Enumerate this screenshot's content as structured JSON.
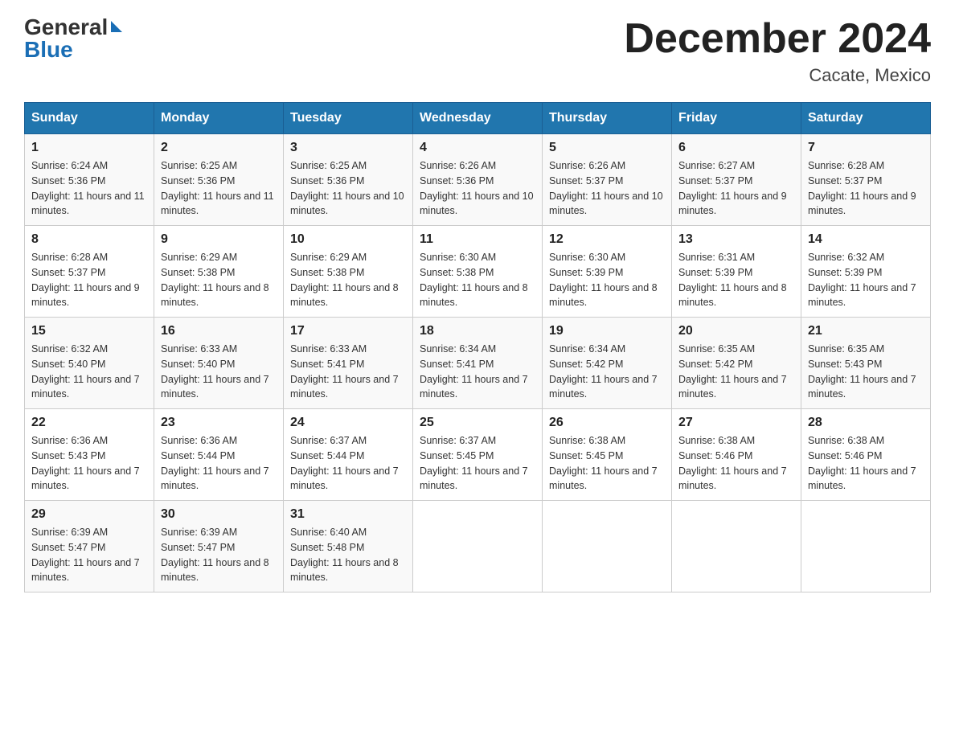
{
  "header": {
    "logo_general": "General",
    "logo_blue": "Blue",
    "month_year": "December 2024",
    "location": "Cacate, Mexico"
  },
  "weekdays": [
    "Sunday",
    "Monday",
    "Tuesday",
    "Wednesday",
    "Thursday",
    "Friday",
    "Saturday"
  ],
  "weeks": [
    [
      {
        "day": "1",
        "sunrise": "6:24 AM",
        "sunset": "5:36 PM",
        "daylight": "11 hours and 11 minutes."
      },
      {
        "day": "2",
        "sunrise": "6:25 AM",
        "sunset": "5:36 PM",
        "daylight": "11 hours and 11 minutes."
      },
      {
        "day": "3",
        "sunrise": "6:25 AM",
        "sunset": "5:36 PM",
        "daylight": "11 hours and 10 minutes."
      },
      {
        "day": "4",
        "sunrise": "6:26 AM",
        "sunset": "5:36 PM",
        "daylight": "11 hours and 10 minutes."
      },
      {
        "day": "5",
        "sunrise": "6:26 AM",
        "sunset": "5:37 PM",
        "daylight": "11 hours and 10 minutes."
      },
      {
        "day": "6",
        "sunrise": "6:27 AM",
        "sunset": "5:37 PM",
        "daylight": "11 hours and 9 minutes."
      },
      {
        "day": "7",
        "sunrise": "6:28 AM",
        "sunset": "5:37 PM",
        "daylight": "11 hours and 9 minutes."
      }
    ],
    [
      {
        "day": "8",
        "sunrise": "6:28 AM",
        "sunset": "5:37 PM",
        "daylight": "11 hours and 9 minutes."
      },
      {
        "day": "9",
        "sunrise": "6:29 AM",
        "sunset": "5:38 PM",
        "daylight": "11 hours and 8 minutes."
      },
      {
        "day": "10",
        "sunrise": "6:29 AM",
        "sunset": "5:38 PM",
        "daylight": "11 hours and 8 minutes."
      },
      {
        "day": "11",
        "sunrise": "6:30 AM",
        "sunset": "5:38 PM",
        "daylight": "11 hours and 8 minutes."
      },
      {
        "day": "12",
        "sunrise": "6:30 AM",
        "sunset": "5:39 PM",
        "daylight": "11 hours and 8 minutes."
      },
      {
        "day": "13",
        "sunrise": "6:31 AM",
        "sunset": "5:39 PM",
        "daylight": "11 hours and 8 minutes."
      },
      {
        "day": "14",
        "sunrise": "6:32 AM",
        "sunset": "5:39 PM",
        "daylight": "11 hours and 7 minutes."
      }
    ],
    [
      {
        "day": "15",
        "sunrise": "6:32 AM",
        "sunset": "5:40 PM",
        "daylight": "11 hours and 7 minutes."
      },
      {
        "day": "16",
        "sunrise": "6:33 AM",
        "sunset": "5:40 PM",
        "daylight": "11 hours and 7 minutes."
      },
      {
        "day": "17",
        "sunrise": "6:33 AM",
        "sunset": "5:41 PM",
        "daylight": "11 hours and 7 minutes."
      },
      {
        "day": "18",
        "sunrise": "6:34 AM",
        "sunset": "5:41 PM",
        "daylight": "11 hours and 7 minutes."
      },
      {
        "day": "19",
        "sunrise": "6:34 AM",
        "sunset": "5:42 PM",
        "daylight": "11 hours and 7 minutes."
      },
      {
        "day": "20",
        "sunrise": "6:35 AM",
        "sunset": "5:42 PM",
        "daylight": "11 hours and 7 minutes."
      },
      {
        "day": "21",
        "sunrise": "6:35 AM",
        "sunset": "5:43 PM",
        "daylight": "11 hours and 7 minutes."
      }
    ],
    [
      {
        "day": "22",
        "sunrise": "6:36 AM",
        "sunset": "5:43 PM",
        "daylight": "11 hours and 7 minutes."
      },
      {
        "day": "23",
        "sunrise": "6:36 AM",
        "sunset": "5:44 PM",
        "daylight": "11 hours and 7 minutes."
      },
      {
        "day": "24",
        "sunrise": "6:37 AM",
        "sunset": "5:44 PM",
        "daylight": "11 hours and 7 minutes."
      },
      {
        "day": "25",
        "sunrise": "6:37 AM",
        "sunset": "5:45 PM",
        "daylight": "11 hours and 7 minutes."
      },
      {
        "day": "26",
        "sunrise": "6:38 AM",
        "sunset": "5:45 PM",
        "daylight": "11 hours and 7 minutes."
      },
      {
        "day": "27",
        "sunrise": "6:38 AM",
        "sunset": "5:46 PM",
        "daylight": "11 hours and 7 minutes."
      },
      {
        "day": "28",
        "sunrise": "6:38 AM",
        "sunset": "5:46 PM",
        "daylight": "11 hours and 7 minutes."
      }
    ],
    [
      {
        "day": "29",
        "sunrise": "6:39 AM",
        "sunset": "5:47 PM",
        "daylight": "11 hours and 7 minutes."
      },
      {
        "day": "30",
        "sunrise": "6:39 AM",
        "sunset": "5:47 PM",
        "daylight": "11 hours and 8 minutes."
      },
      {
        "day": "31",
        "sunrise": "6:40 AM",
        "sunset": "5:48 PM",
        "daylight": "11 hours and 8 minutes."
      },
      null,
      null,
      null,
      null
    ]
  ]
}
